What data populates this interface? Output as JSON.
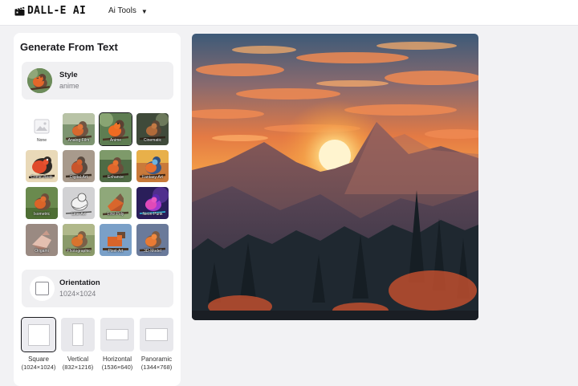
{
  "header": {
    "logo_text": "DALL-E AI",
    "logo_icon": "clapperboard-icon",
    "menu_label": "Ai Tools",
    "menu_icon": "caret-down-icon"
  },
  "panel": {
    "title": "Generate From Text",
    "style": {
      "label": "Style",
      "value": "anime"
    },
    "styles": [
      {
        "name": "None",
        "selected": false
      },
      {
        "name": "Analog-Film",
        "selected": false
      },
      {
        "name": "Anime",
        "selected": true
      },
      {
        "name": "Cinematic",
        "selected": false
      },
      {
        "name": "Comic-Book",
        "selected": false
      },
      {
        "name": "Digital-Art",
        "selected": false
      },
      {
        "name": "Enhance",
        "selected": false
      },
      {
        "name": "Fantasy-Art",
        "selected": false
      },
      {
        "name": "Isometric",
        "selected": false
      },
      {
        "name": "Line-Art",
        "selected": false
      },
      {
        "name": "Low-Poly",
        "selected": false
      },
      {
        "name": "Neon-Punk",
        "selected": false
      },
      {
        "name": "Origami",
        "selected": false
      },
      {
        "name": "Photographic",
        "selected": false
      },
      {
        "name": "Pixel-Art",
        "selected": false
      },
      {
        "name": "3D-Model",
        "selected": false
      }
    ],
    "orientation": {
      "label": "Orientation",
      "value": "1024×1024",
      "options": [
        {
          "name": "Square",
          "dims": "(1024×1024)",
          "selected": true
        },
        {
          "name": "Vertical",
          "dims": "(832×1216)",
          "selected": false
        },
        {
          "name": "Horizontal",
          "dims": "(1536×640)",
          "selected": false
        },
        {
          "name": "Panoramic",
          "dims": "(1344×768)",
          "selected": false
        }
      ]
    }
  },
  "colors": {
    "accent": "#1b1b1f",
    "panel_bg": "#ffffff",
    "page_bg": "#f2f2f4",
    "setting_bg": "#f0f0f2"
  }
}
